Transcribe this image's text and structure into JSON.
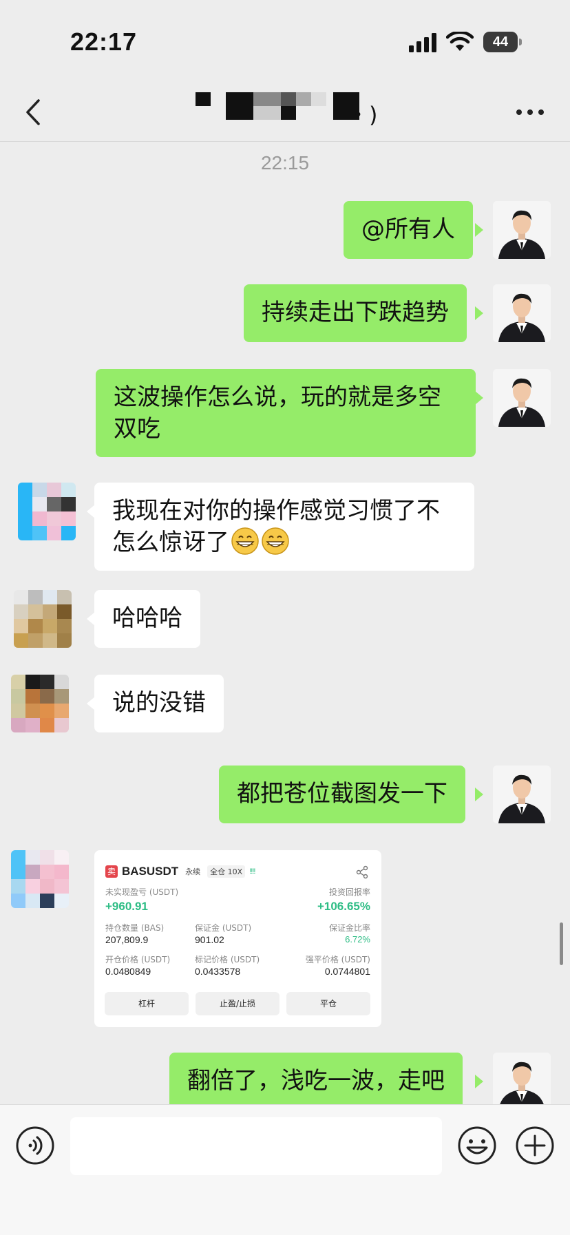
{
  "status_bar": {
    "time": "22:17",
    "battery": "44"
  },
  "nav": {
    "title_visible_suffix": "・)"
  },
  "chat": {
    "timestamp": "22:15",
    "messages": [
      {
        "side": "out",
        "text": "@所有人"
      },
      {
        "side": "out",
        "text": "持续走出下跌趋势"
      },
      {
        "side": "out",
        "text": "这波操作怎么说，玩的就是多空双吃"
      },
      {
        "side": "in",
        "text": "我现在对你的操作感觉习惯了不怎么惊讶了",
        "emoji": [
          "grin-emoji",
          "grin-emoji"
        ]
      },
      {
        "side": "in",
        "text": "哈哈哈"
      },
      {
        "side": "in",
        "text": "说的没错"
      },
      {
        "side": "out",
        "text": "都把苍位截图发一下"
      },
      {
        "side": "in",
        "type": "image"
      },
      {
        "side": "out",
        "text": "翻倍了，浅吃一波，走吧"
      }
    ]
  },
  "trade_card": {
    "sell_tag": "卖",
    "symbol": "BASUSDT",
    "contract_type": "永续",
    "margin_mode": "全仓 10X",
    "leverage_bars": "!!!!",
    "unrealized_pnl_label": "未实现盈亏 (USDT)",
    "unrealized_pnl": "+960.91",
    "roi_label": "投资回报率",
    "roi": "+106.65%",
    "position_size_label": "持仓数量 (BAS)",
    "position_size": "207,809.9",
    "margin_label": "保证金 (USDT)",
    "margin": "901.02",
    "margin_ratio_label": "保证金比率",
    "margin_ratio": "6.72%",
    "entry_price_label": "开仓价格 (USDT)",
    "entry_price": "0.0480849",
    "mark_price_label": "标记价格 (USDT)",
    "mark_price": "0.0433578",
    "liq_price_label": "强平价格 (USDT)",
    "liq_price": "0.0744801",
    "buttons": [
      "杠杆",
      "止盈/止损",
      "平仓"
    ]
  },
  "input_bar": {
    "text_value": ""
  },
  "colors": {
    "background": "#ededed",
    "outgoing_bubble": "#95ec69",
    "incoming_bubble": "#ffffff",
    "profit_green": "#2ebd85",
    "sell_red": "#e4454c"
  }
}
